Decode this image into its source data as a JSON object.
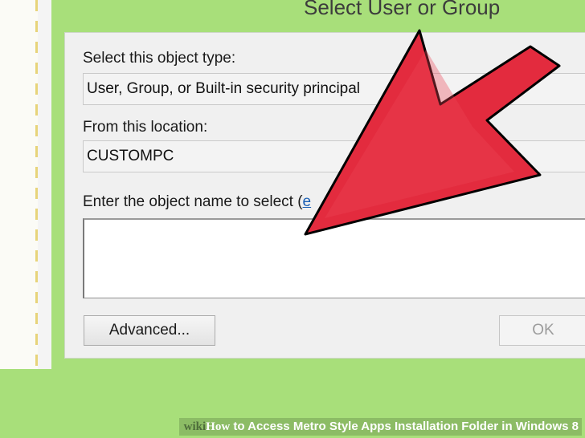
{
  "dialog": {
    "title": "Select User or Group",
    "object_type_label": "Select this object type:",
    "object_type_value": "User, Group, or Built-in security principal",
    "location_label": "From this location:",
    "location_value": "CUSTOMPC",
    "object_name_label": "Enter the object name to select (",
    "object_name_label_link": "e",
    "object_name_value": "",
    "advanced_button": "Advanced...",
    "ok_button": "OK"
  },
  "caption": {
    "logo_wiki": "wiki",
    "logo_how": "How",
    "text": " to Access Metro Style Apps Installation Folder in Windows 8"
  },
  "colors": {
    "frame_green": "#a8df7a",
    "arrow_red": "#e32b3e",
    "arrow_outline": "#000000"
  },
  "icons": {
    "annotation": "red-arrow-pointer-icon"
  }
}
